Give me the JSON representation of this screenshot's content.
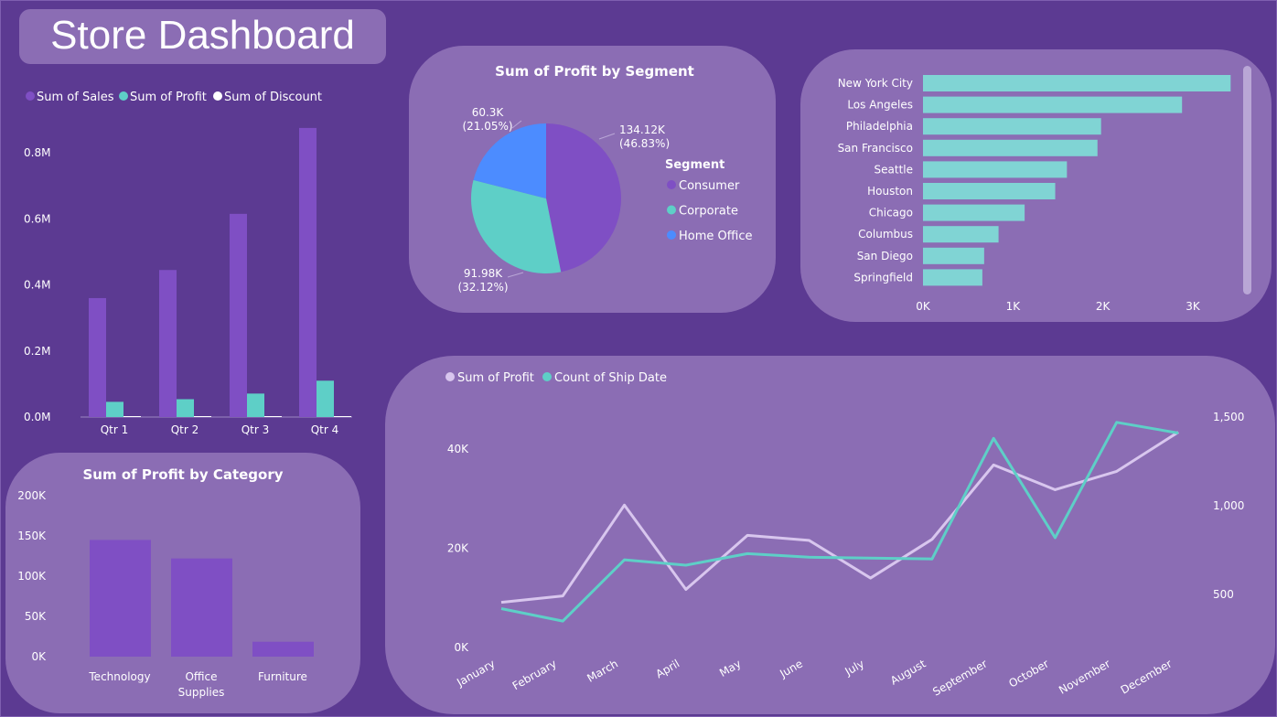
{
  "dashboard_title": "Store Dashboard",
  "colors": {
    "sales": "#7f4fc4",
    "profit": "#5ecfc7",
    "discount": "#ffffff",
    "home_office": "#4c8cff",
    "line_profit": "#d8c6ee",
    "line_ship": "#5ecfc7",
    "city_bar": "#80d4d4"
  },
  "chart_data": [
    {
      "id": "quarterly",
      "type": "bar",
      "title": "",
      "categories": [
        "Qtr 1",
        "Qtr 2",
        "Qtr 3",
        "Qtr 4"
      ],
      "series": [
        {
          "name": "Sum of Sales",
          "values": [
            360000,
            445000,
            615000,
            875000
          ]
        },
        {
          "name": "Sum of Profit",
          "values": [
            46000,
            54000,
            71000,
            110000
          ]
        },
        {
          "name": "Sum of Discount",
          "values": [
            300,
            310,
            330,
            350
          ]
        }
      ],
      "ylim": [
        0,
        900000
      ],
      "yticks": [
        "0.0M",
        "0.2M",
        "0.4M",
        "0.6M",
        "0.8M"
      ],
      "legend": "top-left"
    },
    {
      "id": "category",
      "type": "bar",
      "title": "Sum of Profit by Category",
      "categories": [
        "Technology",
        "Office Supplies",
        "Furniture"
      ],
      "values": [
        145000,
        122000,
        18500
      ],
      "ylim": [
        0,
        200000
      ],
      "yticks": [
        "0K",
        "50K",
        "100K",
        "150K",
        "200K"
      ]
    },
    {
      "id": "segment",
      "type": "pie",
      "title": "Sum of Profit by Segment",
      "legend_title": "Segment",
      "slices": [
        {
          "name": "Consumer",
          "value": 134.12,
          "label": "134.12K",
          "pct": "(46.83%)"
        },
        {
          "name": "Corporate",
          "value": 91.98,
          "label": "91.98K",
          "pct": "(32.12%)"
        },
        {
          "name": "Home Office",
          "value": 60.3,
          "label": "60.3K",
          "pct": "(21.05%)"
        }
      ],
      "legend": "right"
    },
    {
      "id": "cities",
      "type": "bar",
      "orientation": "horizontal",
      "title": "",
      "categories": [
        "New York City",
        "Los Angeles",
        "Philadelphia",
        "San Francisco",
        "Seattle",
        "Houston",
        "Chicago",
        "Columbus",
        "San Diego",
        "Springfield"
      ],
      "values": [
        3420,
        2880,
        1980,
        1940,
        1600,
        1470,
        1130,
        840,
        680,
        660
      ],
      "xlim": [
        0,
        3500
      ],
      "xticks": [
        "0K",
        "1K",
        "2K",
        "3K"
      ]
    },
    {
      "id": "monthly",
      "type": "line",
      "title": "",
      "categories": [
        "January",
        "February",
        "March",
        "April",
        "May",
        "June",
        "July",
        "August",
        "September",
        "October",
        "November",
        "December"
      ],
      "series": [
        {
          "name": "Sum of Profit",
          "axis": "left",
          "values": [
            9100,
            10400,
            28700,
            11700,
            22600,
            21600,
            14000,
            21800,
            36800,
            31800,
            35500,
            43400
          ]
        },
        {
          "name": "Count of Ship Date",
          "axis": "right",
          "values": [
            420,
            350,
            695,
            665,
            730,
            710,
            705,
            700,
            1380,
            820,
            1470,
            1410
          ]
        }
      ],
      "y_left_lim": [
        0,
        48000
      ],
      "y_left_ticks": [
        "0K",
        "20K",
        "40K"
      ],
      "y_right_lim": [
        190,
        1540
      ],
      "y_right_ticks": [
        "500",
        "1,000",
        "1,500"
      ],
      "legend": "top-left"
    }
  ]
}
